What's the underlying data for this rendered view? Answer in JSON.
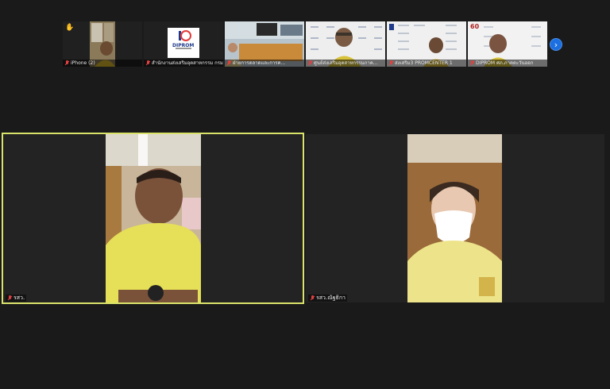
{
  "thumbnails": [
    {
      "label": "iPhone (2)",
      "muted": true,
      "hand_raised": true
    },
    {
      "label": "สำนักงานส่งเสริมอุตสาหกรรม กรมส่งเสริ...",
      "muted": true,
      "logo_text": "DIPROM"
    },
    {
      "label": "ฝ่ายการตลาดและการค...",
      "muted": true
    },
    {
      "label": "ศูนย์ส่งเสริมอุตสาหกรรมภาค...",
      "muted": true
    },
    {
      "label": "ส่งเสริม3 PROMCENTER 1",
      "muted": true
    },
    {
      "label": "DIPROM ศภ.ภาคตะวันออก",
      "muted": true,
      "badge_text": "60"
    }
  ],
  "main_tiles": [
    {
      "label": "รสว.",
      "muted": true,
      "active": true
    },
    {
      "label": "รสว.ณัฐธิกา",
      "muted": true,
      "active": false
    }
  ],
  "controls": {
    "next_icon": "chevron-right-icon",
    "next_glyph": "›"
  },
  "colors": {
    "accent_border": "#d9e36a",
    "next_button": "#1b6fe0",
    "mic_off": "#e04040"
  }
}
